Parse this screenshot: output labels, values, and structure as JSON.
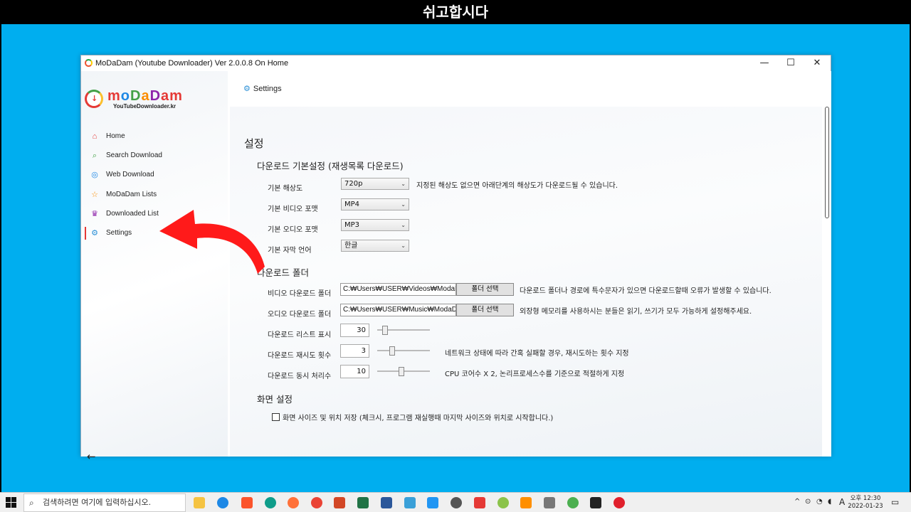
{
  "banner": {
    "title": "쉬고합시다"
  },
  "window": {
    "title": "MoDaDam (Youtube Downloader) Ver 2.0.0.8 On Home",
    "controls": {
      "minimize": "—",
      "maximize": "☐",
      "close": "✕"
    }
  },
  "logo": {
    "brand_letters": [
      "m",
      "o",
      "D",
      "a",
      "D",
      "am"
    ],
    "subtitle": "YouTubeDownloader.kr"
  },
  "sidebar": {
    "items": [
      {
        "label": "Home",
        "icon": "⌂",
        "icon_name": "home-icon"
      },
      {
        "label": "Search Download",
        "icon": "⌕",
        "icon_name": "search-icon"
      },
      {
        "label": "Web Download",
        "icon": "◎",
        "icon_name": "globe-icon"
      },
      {
        "label": "MoDaDam Lists",
        "icon": "☆",
        "icon_name": "star-icon"
      },
      {
        "label": "Downloaded List",
        "icon": "♛",
        "icon_name": "downloaded-icon"
      },
      {
        "label": "Settings",
        "icon": "⚙",
        "icon_name": "gear-icon"
      }
    ],
    "back": "←"
  },
  "breadcrumb": {
    "icon": "⚙",
    "label": "Settings"
  },
  "settings": {
    "title": "설정",
    "download_basic": {
      "heading": "다운로드 기본설정 (재생목록 다운로드)",
      "resolution_label": "기본 해상도",
      "resolution_value": "720p",
      "resolution_note": "지정된 해상도 없으면 아래단계의 해상도가 다운로드될 수 있습니다.",
      "video_format_label": "기본 비디오 포맷",
      "video_format_value": "MP4",
      "audio_format_label": "기본 오디오 포맷",
      "audio_format_value": "MP3",
      "subtitle_lang_label": "기본 자막 언어",
      "subtitle_lang_value": "한글"
    },
    "download_folder": {
      "heading": "다운로드 폴더",
      "video_label": "비디오 다운로드 폴더",
      "video_path": "C:₩Users₩USER₩Videos₩ModaDam",
      "video_button": "폴더 선택",
      "video_note": "다운로드 폴더나 경로에 특수문자가 있으면 다운로드할때 오류가 발생할 수 있습니다.",
      "audio_label": "오디오 다운로드 폴더",
      "audio_path": "C:₩Users₩USER₩Music₩ModaDam",
      "audio_button": "폴더 선택",
      "audio_note": "외장형 메모리를 사용하시는 분들은 읽기, 쓰기가 모두 가능하게 설정해주세요.",
      "list_display_label": "다운로드 리스트 표시",
      "list_display_value": "30",
      "list_display_level": 0.1,
      "retry_label": "다운로드 재시도 횟수",
      "retry_value": "3",
      "retry_level": 0.25,
      "retry_note": "네트워크 상태에 따라 간혹 실패할 경우, 재시도하는 횟수 지정",
      "concurrent_label": "다운로드 동시 처리수",
      "concurrent_value": "10",
      "concurrent_level": 0.45,
      "concurrent_note": "CPU 코어수 X 2, 논리프로세스수를 기준으로 적절하게 지정"
    },
    "screen": {
      "heading": "화면 설정",
      "save_layout_label": "화면 사이즈 및 위치 저장 (체크시, 프로그램 재실행때 마지막 사이즈와 위치로 시작합니다.)",
      "save_layout_checked": false
    }
  },
  "taskbar": {
    "search_placeholder": "검색하려면 여기에 입력하십시오.",
    "tray_caret": "^",
    "ime": "A",
    "clock_time": "오후 12:30",
    "clock_date": "2022-01-23"
  },
  "colors": {
    "desktop": "#00aeef",
    "accent_red": "#e53935",
    "link_blue": "#2a8fd6"
  }
}
